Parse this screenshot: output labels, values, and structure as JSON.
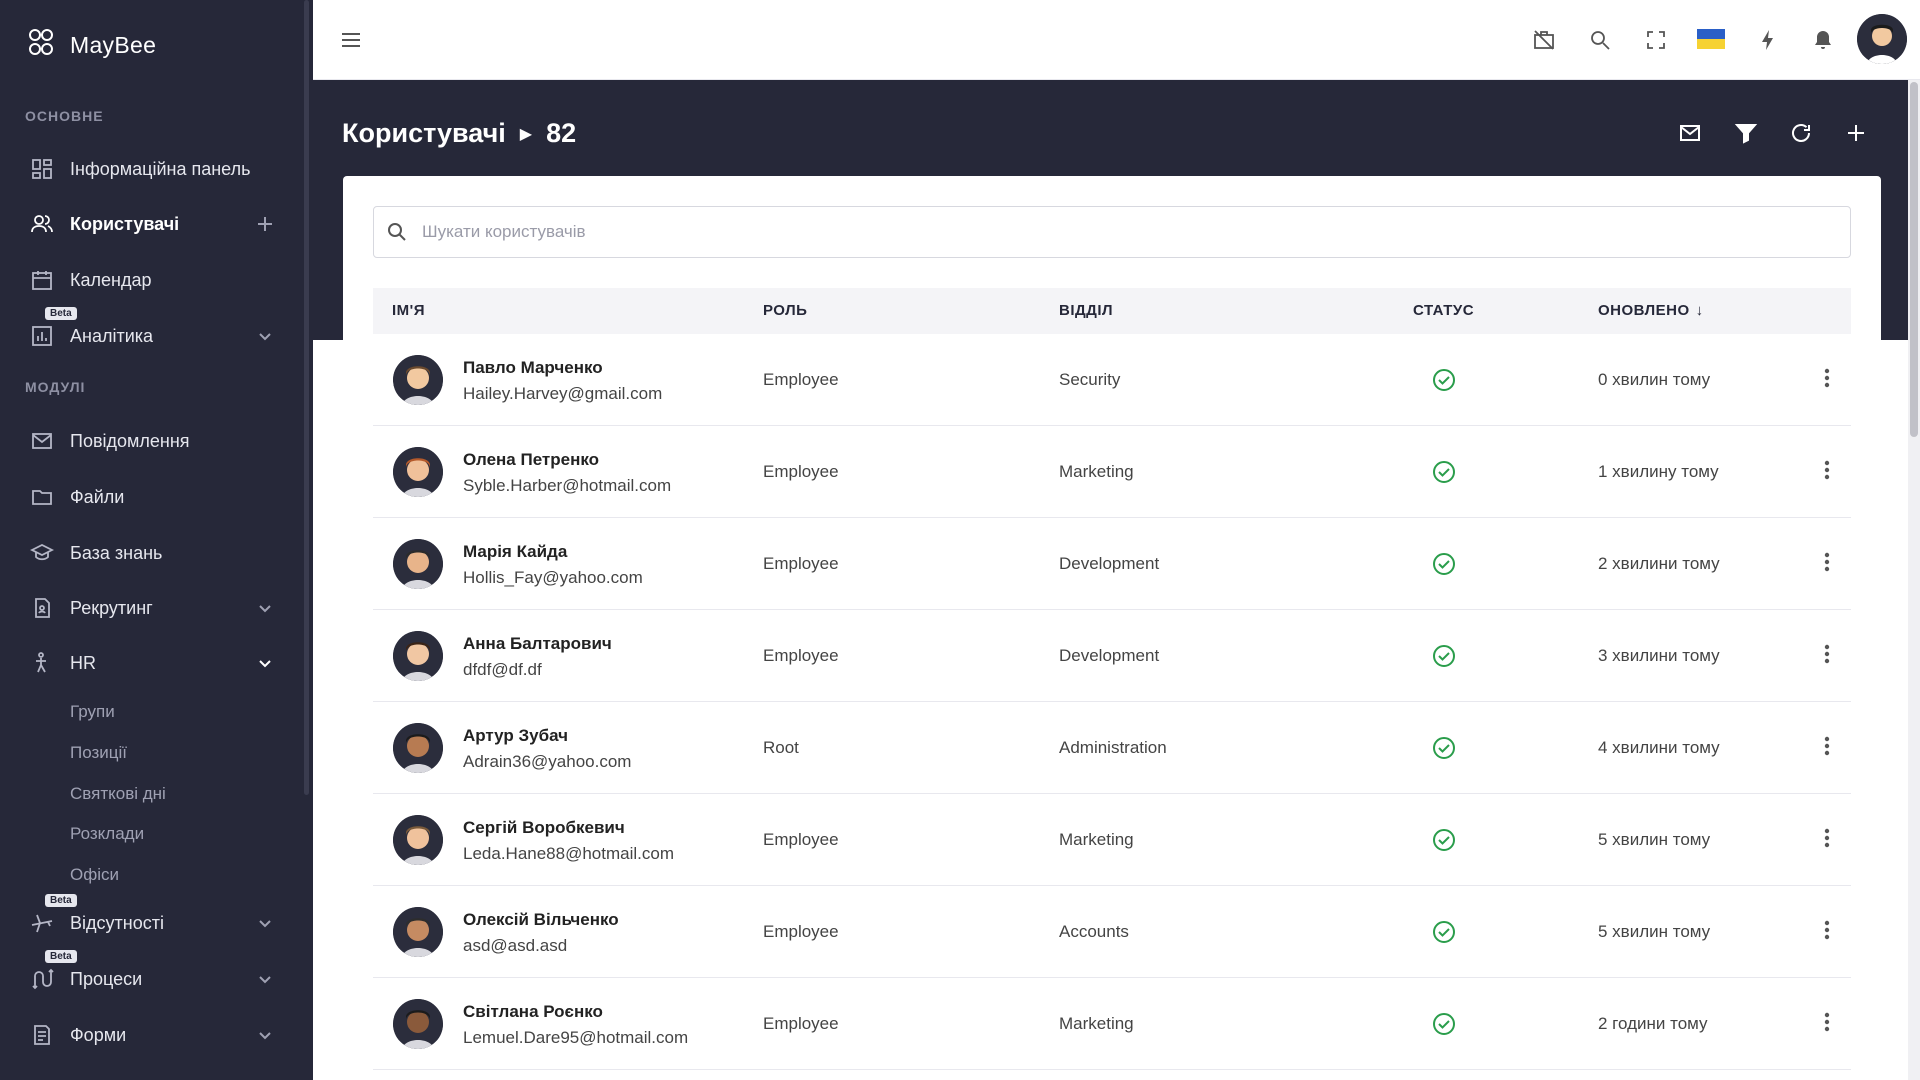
{
  "app": {
    "name": "MayBee"
  },
  "sidebar": {
    "sections": {
      "main": "ОСНОВНЕ",
      "modules": "МОДУЛІ"
    },
    "items": [
      {
        "label": "Інформаційна панель",
        "icon": "dashboard-icon"
      },
      {
        "label": "Користувачі",
        "icon": "users-icon",
        "active": true
      },
      {
        "label": "Календар",
        "icon": "calendar-icon"
      },
      {
        "label": "Аналітика",
        "icon": "chart-icon",
        "beta": "Beta"
      },
      {
        "label": "Повідомлення",
        "icon": "mail-icon"
      },
      {
        "label": "Файли",
        "icon": "folder-icon"
      },
      {
        "label": "База знань",
        "icon": "graduation-icon"
      },
      {
        "label": "Рекрутинг",
        "icon": "document-icon"
      },
      {
        "label": "HR",
        "icon": "person-icon"
      },
      {
        "label": "Відсутності",
        "icon": "plane-icon",
        "beta": "Beta"
      },
      {
        "label": "Процеси",
        "icon": "flow-icon",
        "beta": "Beta"
      },
      {
        "label": "Форми",
        "icon": "form-icon"
      }
    ],
    "hr_sub": [
      "Групи",
      "Позиції",
      "Святкові дні",
      "Розклади",
      "Офіси"
    ]
  },
  "page": {
    "title": "Користувачі",
    "count": "82"
  },
  "search": {
    "placeholder": "Шукати користувачів"
  },
  "table": {
    "headers": {
      "name": "ІМ'Я",
      "role": "РОЛЬ",
      "dept": "ВІДДІЛ",
      "status": "СТАТУС",
      "updated": "ОНОВЛЕНО"
    },
    "rows": [
      {
        "name": "Павло Марченко",
        "email": "Hailey.Harvey@gmail.com",
        "role": "Employee",
        "dept": "Security",
        "updated": "0 хвилин тому"
      },
      {
        "name": "Олена Петренко",
        "email": "Syble.Harber@hotmail.com",
        "role": "Employee",
        "dept": "Marketing",
        "updated": "1 хвилину тому"
      },
      {
        "name": "Марія Кайда",
        "email": "Hollis_Fay@yahoo.com",
        "role": "Employee",
        "dept": "Development",
        "updated": "2 хвилини тому"
      },
      {
        "name": "Анна Балтарович",
        "email": "dfdf@df.df",
        "role": "Employee",
        "dept": "Development",
        "updated": "3 хвилини тому"
      },
      {
        "name": "Артур Зубач",
        "email": "Adrain36@yahoo.com",
        "role": "Root",
        "dept": "Administration",
        "updated": "4 хвилини тому"
      },
      {
        "name": "Сергій Воробкевич",
        "email": "Leda.Hane88@hotmail.com",
        "role": "Employee",
        "dept": "Marketing",
        "updated": "5 хвилин тому"
      },
      {
        "name": "Олексій Вільченко",
        "email": "asd@asd.asd",
        "role": "Employee",
        "dept": "Accounts",
        "updated": "5 хвилин тому"
      },
      {
        "name": "Світлана Роєнко",
        "email": "Lemuel.Dare95@hotmail.com",
        "role": "Employee",
        "dept": "Marketing",
        "updated": "2 години тому"
      }
    ]
  },
  "colors": {
    "sidebar": "#262839",
    "status_ok": "#2a9d4b",
    "flag_blue": "#2a5fc7",
    "flag_yellow": "#f6d232"
  }
}
